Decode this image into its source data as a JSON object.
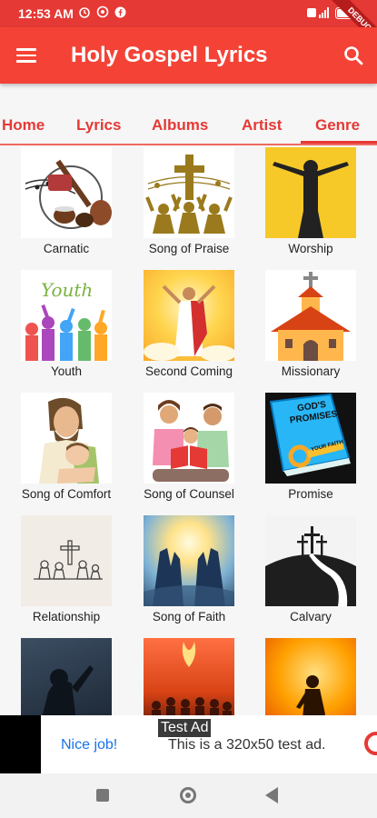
{
  "status_bar": {
    "time": "12:53 AM",
    "battery": "78",
    "debug_label": "DEBUG"
  },
  "app_bar": {
    "title": "Holy Gospel Lyrics"
  },
  "tabs": [
    {
      "label": "Home"
    },
    {
      "label": "Lyrics"
    },
    {
      "label": "Albums"
    },
    {
      "label": "Artist"
    },
    {
      "label": "Genre",
      "active": true
    }
  ],
  "genres": [
    {
      "label": "Carnatic"
    },
    {
      "label": "Song of Praise"
    },
    {
      "label": "Worship"
    },
    {
      "label": "Youth",
      "image_text": "Youth"
    },
    {
      "label": "Second Coming"
    },
    {
      "label": "Missionary"
    },
    {
      "label": "Song of Comfort"
    },
    {
      "label": "Song of Counsel"
    },
    {
      "label": "Promise",
      "image_text": "GOD'S PROMISES",
      "key_text": "YOUR FAITH"
    },
    {
      "label": "Relationship"
    },
    {
      "label": "Song of Faith"
    },
    {
      "label": "Calvary"
    },
    {
      "label": ""
    },
    {
      "label": ""
    },
    {
      "label": ""
    }
  ],
  "ad": {
    "tag": "Test Ad",
    "headline": "Nice job!",
    "body": "This is a 320x50 test ad."
  },
  "colors": {
    "primary": "#f44336",
    "status_bar": "#e53935",
    "accent_text": "#e53935"
  }
}
